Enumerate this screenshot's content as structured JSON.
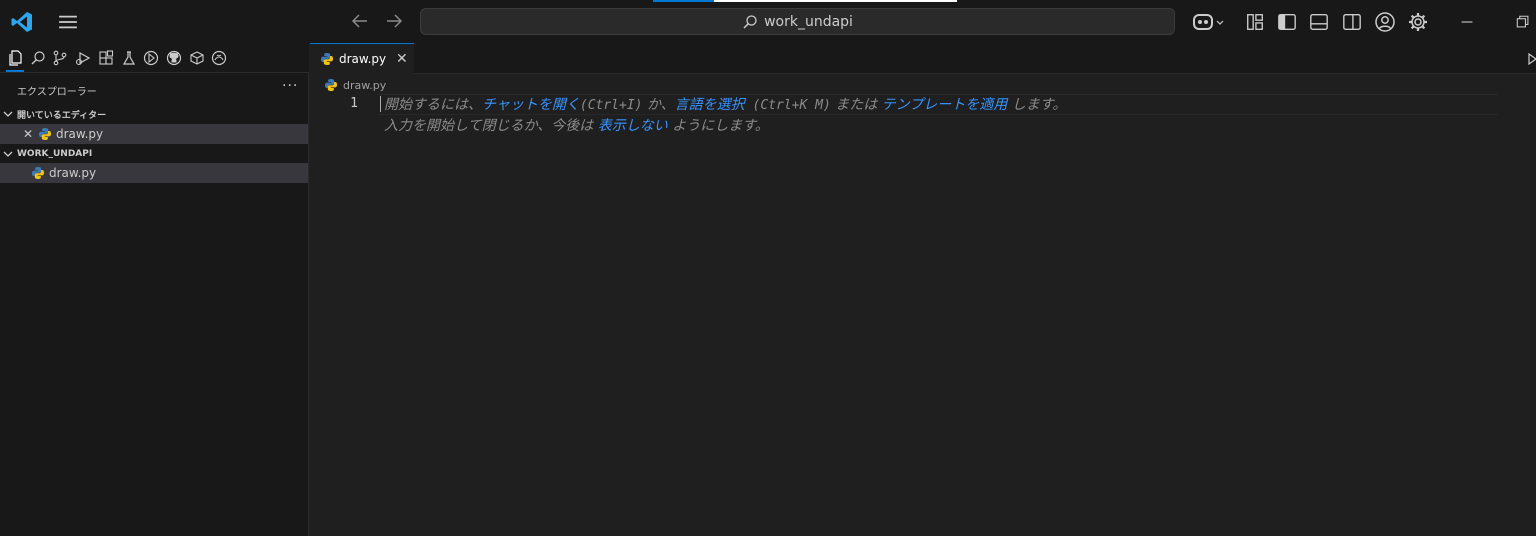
{
  "titlebar": {
    "search_text": "work_undapi",
    "icons": [
      "vscode-logo-icon",
      "hamburger-menu-icon",
      "arrow-left-icon",
      "arrow-right-icon",
      "search-icon",
      "copilot-icon",
      "customize-layout-icon",
      "toggle-sidebar-icon",
      "toggle-panel-icon",
      "toggle-secondary-sidebar-icon",
      "account-icon",
      "settings-gear-icon",
      "minimize-icon",
      "restore-icon"
    ]
  },
  "activitybar": {
    "icons": [
      "explorer-icon",
      "search-icon",
      "source-control-icon",
      "run-debug-icon",
      "extensions-icon",
      "testing-icon",
      "timeline-icon",
      "github-icon",
      "remote-explorer-icon",
      "copilot-chat-icon"
    ]
  },
  "sidebar": {
    "title": "エクスプローラー",
    "more": "···",
    "open_editors": {
      "label": "開いているエディター",
      "files": [
        {
          "name": "draw.py"
        }
      ]
    },
    "workspace": {
      "label": "WORK_UNDAPI",
      "files": [
        {
          "name": "draw.py"
        }
      ]
    }
  },
  "tabs": [
    {
      "label": "draw.py",
      "close": "✕"
    }
  ],
  "breadcrumb": {
    "file": "draw.py"
  },
  "editor": {
    "line_number": "1",
    "hint_line1": {
      "p1": "開始するには、",
      "link1": "チャットを開く",
      "k1": "(Ctrl+I)",
      "p2": " か、",
      "link2": "言語を選択",
      "k2": " (Ctrl+K M)",
      "p3": " または ",
      "link3": "テンプレートを適用",
      "p4": " します。"
    },
    "hint_line2": {
      "p1": "入力を開始して閉じるか、今後は ",
      "link1": "表示しない",
      "p2": " ようにします。"
    }
  },
  "colors": {
    "accent": "#0078d4",
    "link": "#3794ff",
    "background": "#1f1f1f",
    "sidebar": "#181818"
  }
}
